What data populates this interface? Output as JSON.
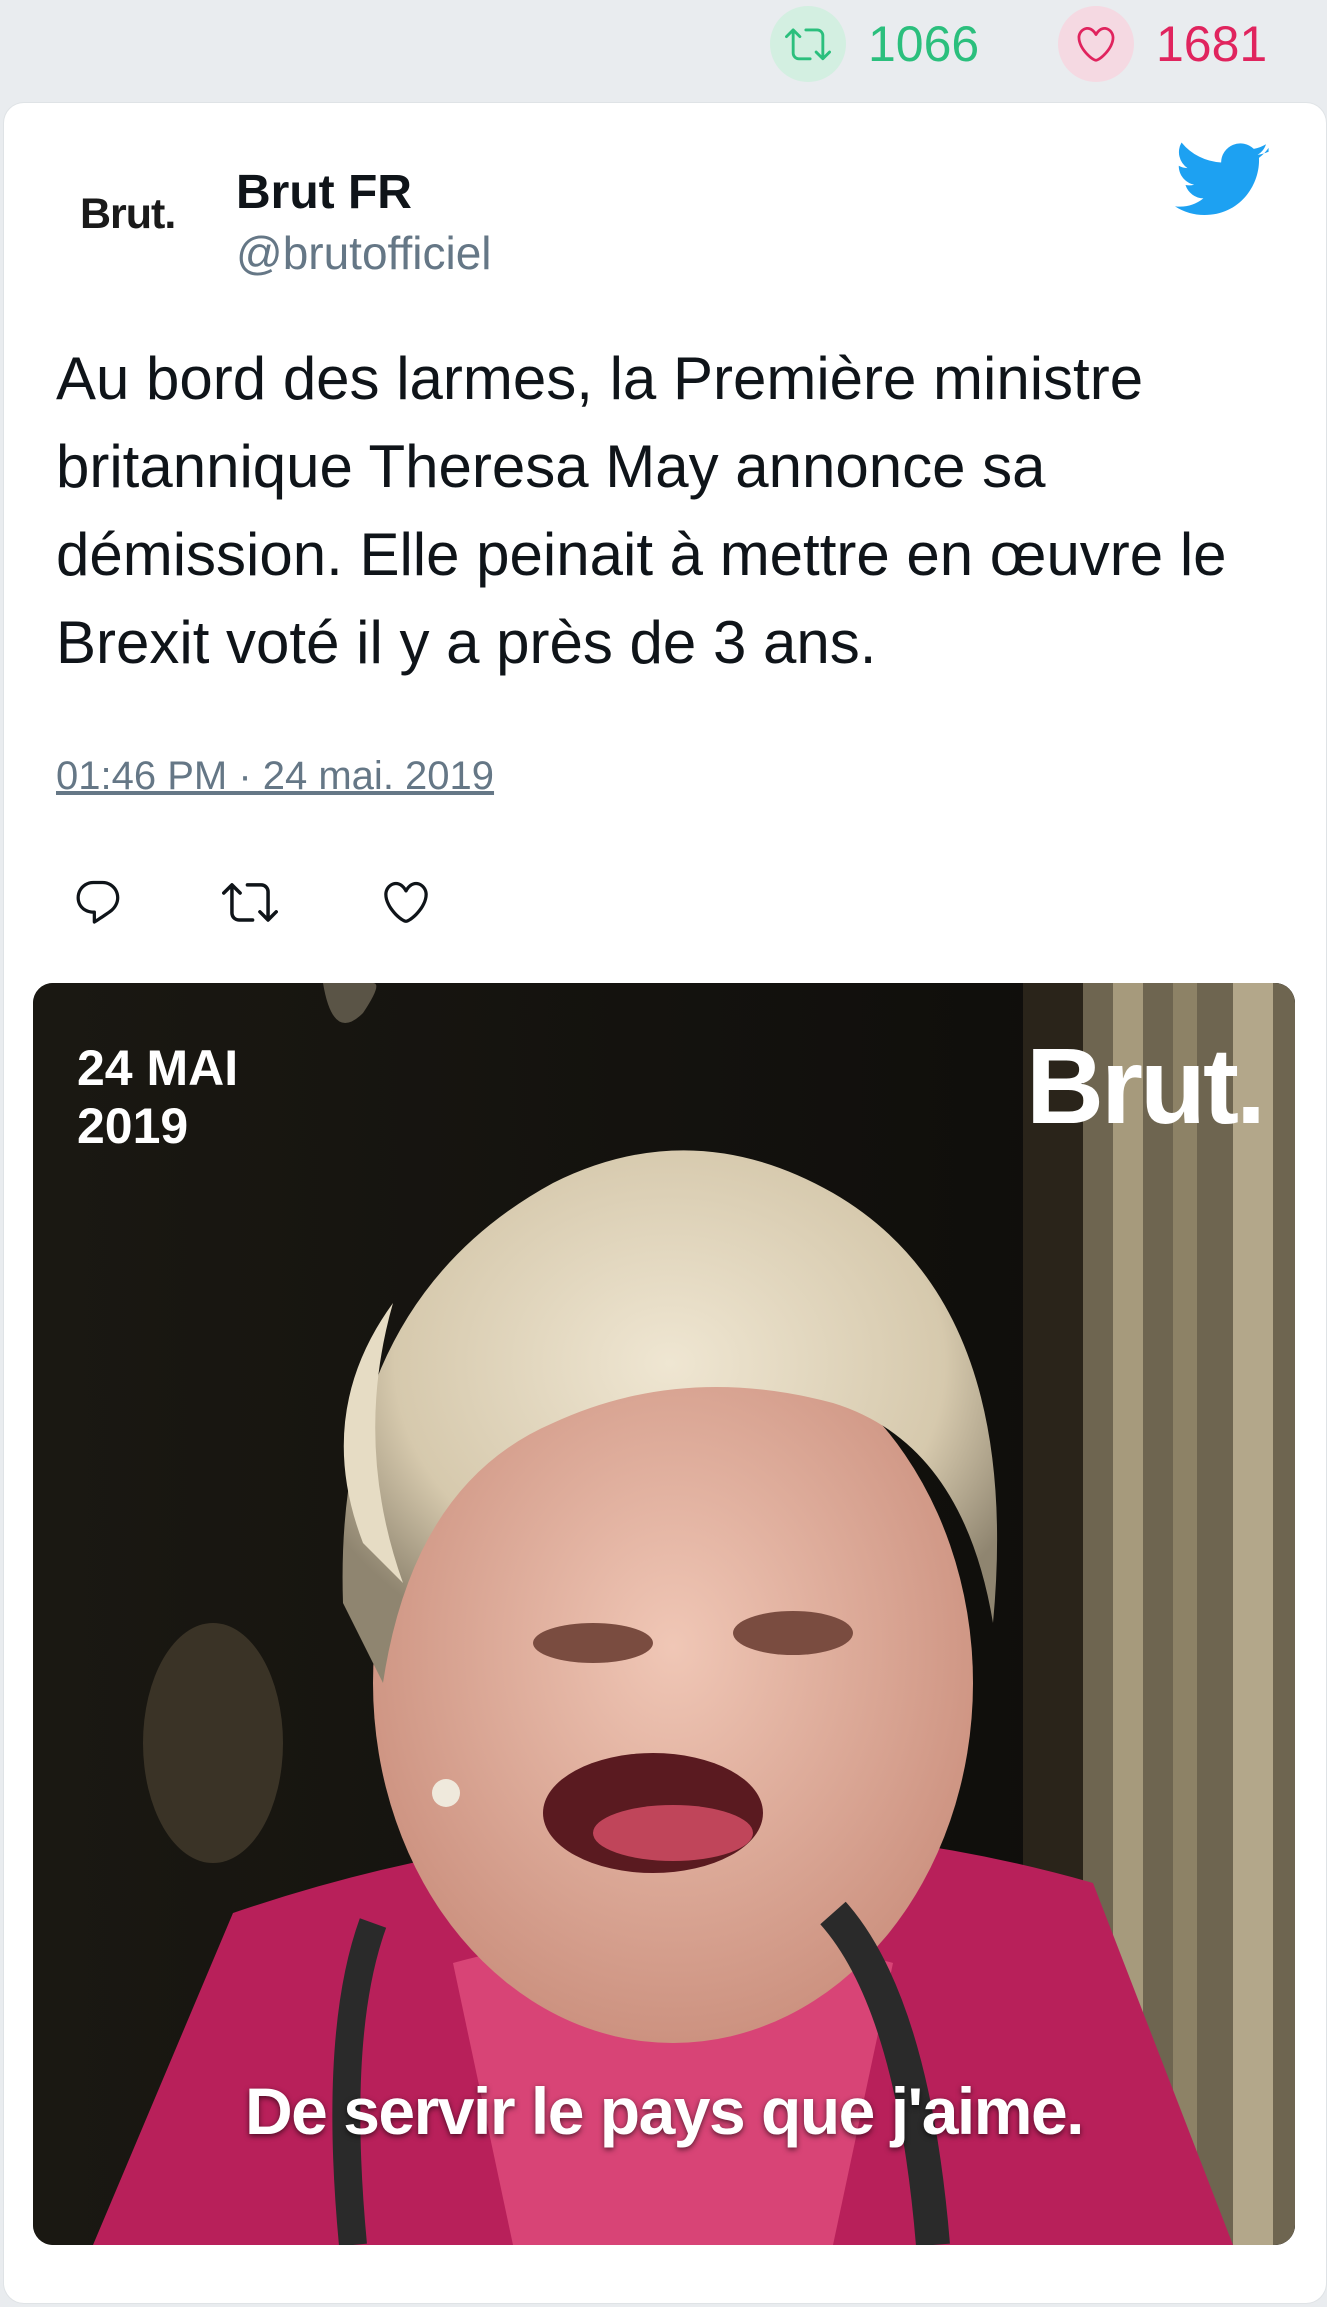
{
  "stats": {
    "retweets": "1066",
    "likes": "1681",
    "retweet_icon": "retweet-icon",
    "like_icon": "heart-icon",
    "retweet_color": "#2bbf7d",
    "like_color": "#e0245e"
  },
  "tweet": {
    "avatar_text": "Brut.",
    "author_name": "Brut FR",
    "author_handle": "@brutofficiel",
    "platform_icon": "twitter-bird-icon",
    "platform_color": "#1da1f2",
    "text": "Au bord des larmes, la Première ministre britannique Theresa May annonce sa démission. Elle peinait à mettre en œuvre le Brexit voté il y a près de 3 ans.",
    "timestamp": "01:46 PM · 24 mai. 2019",
    "actions": [
      "reply-icon",
      "retweet-icon",
      "like-icon"
    ]
  },
  "media": {
    "date_overlay": "24 MAI\n2019",
    "brand_overlay": "Brut.",
    "caption": "De servir le pays que j'aime."
  }
}
